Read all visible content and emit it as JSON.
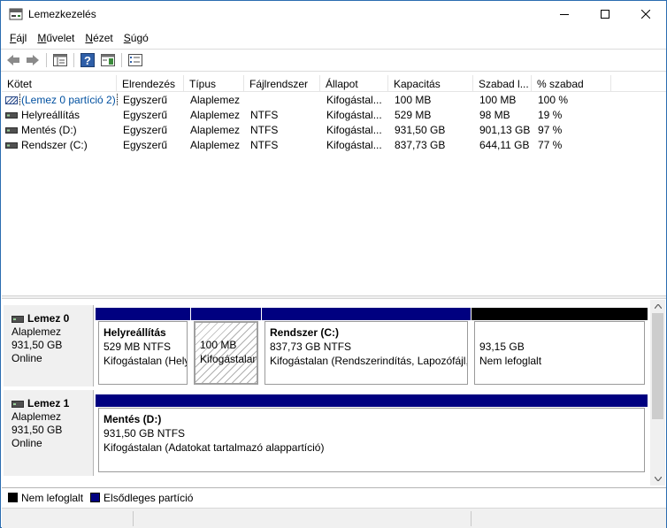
{
  "window": {
    "title": "Lemezkezelés"
  },
  "menu": [
    {
      "label": "Fájl",
      "accel": "F",
      "rest": "ájl"
    },
    {
      "label": "Művelet",
      "accel": "M",
      "rest": "űvelet"
    },
    {
      "label": "Nézet",
      "accel": "N",
      "rest": "ézet"
    },
    {
      "label": "Súgó",
      "accel": "S",
      "rest": "úgó"
    }
  ],
  "volume_list": {
    "columns": [
      "Kötet",
      "Elrendezés",
      "Típus",
      "Fájlrendszer",
      "Állapot",
      "Kapacitás",
      "Szabad l...",
      "% szabad"
    ],
    "rows": [
      {
        "volume": "(Lemez 0 partíció 2)",
        "layout": "Egyszerű",
        "type": "Alaplemez",
        "fs": "",
        "status": "Kifogástal...",
        "capacity": "100 MB",
        "free": "100 MB",
        "pct": "100 %"
      },
      {
        "volume": "Helyreállítás",
        "layout": "Egyszerű",
        "type": "Alaplemez",
        "fs": "NTFS",
        "status": "Kifogástal...",
        "capacity": "529 MB",
        "free": "98 MB",
        "pct": "19 %"
      },
      {
        "volume": "Mentés (D:)",
        "layout": "Egyszerű",
        "type": "Alaplemez",
        "fs": "NTFS",
        "status": "Kifogástal...",
        "capacity": "931,50 GB",
        "free": "901,13 GB",
        "pct": "97 %"
      },
      {
        "volume": "Rendszer (C:)",
        "layout": "Egyszerű",
        "type": "Alaplemez",
        "fs": "NTFS",
        "status": "Kifogástal...",
        "capacity": "837,73 GB",
        "free": "644,11 GB",
        "pct": "77 %"
      }
    ]
  },
  "disks": [
    {
      "name": "Lemez 0",
      "type": "Alaplemez",
      "size": "931,50 GB",
      "state": "Online",
      "partitions": [
        {
          "title": "Helyreállítás",
          "line2": "529 MB NTFS",
          "line3": "Kifogástalan (Helyreállítási partíció)"
        },
        {
          "title": "",
          "line2": "100 MB",
          "line3": "Kifogástalan (EFI rendszerpartíció)"
        },
        {
          "title": "Rendszer  (C:)",
          "line2": "837,73 GB NTFS",
          "line3": "Kifogástalan (Rendszerindítás, Lapozófájl, Összeomlási memóriakép, Alappartíció)"
        },
        {
          "title": "",
          "line2": "93,15 GB",
          "line3": "Nem lefoglalt"
        }
      ]
    },
    {
      "name": "Lemez 1",
      "type": "Alaplemez",
      "size": "931,50 GB",
      "state": "Online",
      "partitions": [
        {
          "title": "Mentés  (D:)",
          "line2": "931,50 GB NTFS",
          "line3": "Kifogástalan (Adatokat tartalmazó alappartíció)"
        }
      ]
    }
  ],
  "legend": [
    {
      "label": "Nem lefoglalt",
      "color": "#000000"
    },
    {
      "label": "Elsődleges partíció",
      "color": "#000080"
    }
  ],
  "colors": {
    "primary": "#000080",
    "unallocated": "#000000",
    "info_bg": "#f0f0f0"
  }
}
